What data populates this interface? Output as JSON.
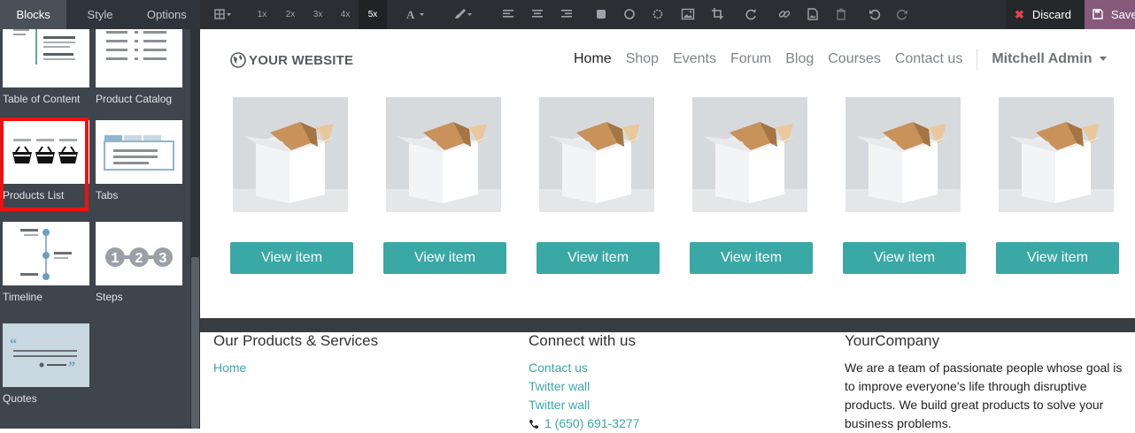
{
  "panel": {
    "tabs": [
      {
        "label": "Blocks",
        "active": true
      },
      {
        "label": "Style",
        "active": false
      },
      {
        "label": "Options",
        "active": false
      }
    ],
    "blocks": [
      {
        "label": "Table of Content",
        "icon": "table-of-content-thumbnail"
      },
      {
        "label": "Product Catalog",
        "icon": "product-catalog-thumbnail"
      },
      {
        "label": "Products List",
        "icon": "products-list-thumbnail",
        "selected": true
      },
      {
        "label": "Tabs",
        "icon": "tabs-thumbnail"
      },
      {
        "label": "Timeline",
        "icon": "timeline-thumbnail"
      },
      {
        "label": "Steps",
        "icon": "steps-thumbnail",
        "steps": [
          "1",
          "2",
          "3"
        ]
      },
      {
        "label": "Quotes",
        "icon": "quotes-thumbnail"
      }
    ],
    "highlight_color": "#ee1111"
  },
  "toolbar": {
    "sizes": [
      "1x",
      "2x",
      "3x",
      "4x",
      "5x"
    ],
    "active_size": "5x",
    "discard_label": "Discard",
    "save_label": "Save",
    "discard_color": "#e5434f",
    "save_color": "#875a7b"
  },
  "site": {
    "logo": "YOUR WEBSITE",
    "nav": [
      {
        "label": "Home",
        "active": true
      },
      {
        "label": "Shop"
      },
      {
        "label": "Events"
      },
      {
        "label": "Forum"
      },
      {
        "label": "Blog"
      },
      {
        "label": "Courses"
      },
      {
        "label": "Contact us"
      }
    ],
    "user": "Mitchell Admin",
    "products": [
      {
        "button": "View item"
      },
      {
        "button": "View item"
      },
      {
        "button": "View item"
      },
      {
        "button": "View item"
      },
      {
        "button": "View item"
      },
      {
        "button": "View item"
      }
    ],
    "accent_color": "#3aa8a4"
  },
  "footer": {
    "col1": {
      "title": "Our Products & Services",
      "links": [
        "Home"
      ]
    },
    "col2": {
      "title": "Connect with us",
      "links": [
        "Contact us",
        "Twitter wall",
        "Twitter wall"
      ],
      "phone": "1 (650) 691-3277"
    },
    "col3": {
      "title": "YourCompany",
      "text": "We are a team of passionate people whose goal is to improve everyone's life through disruptive products. We build great products to solve your business problems."
    }
  }
}
